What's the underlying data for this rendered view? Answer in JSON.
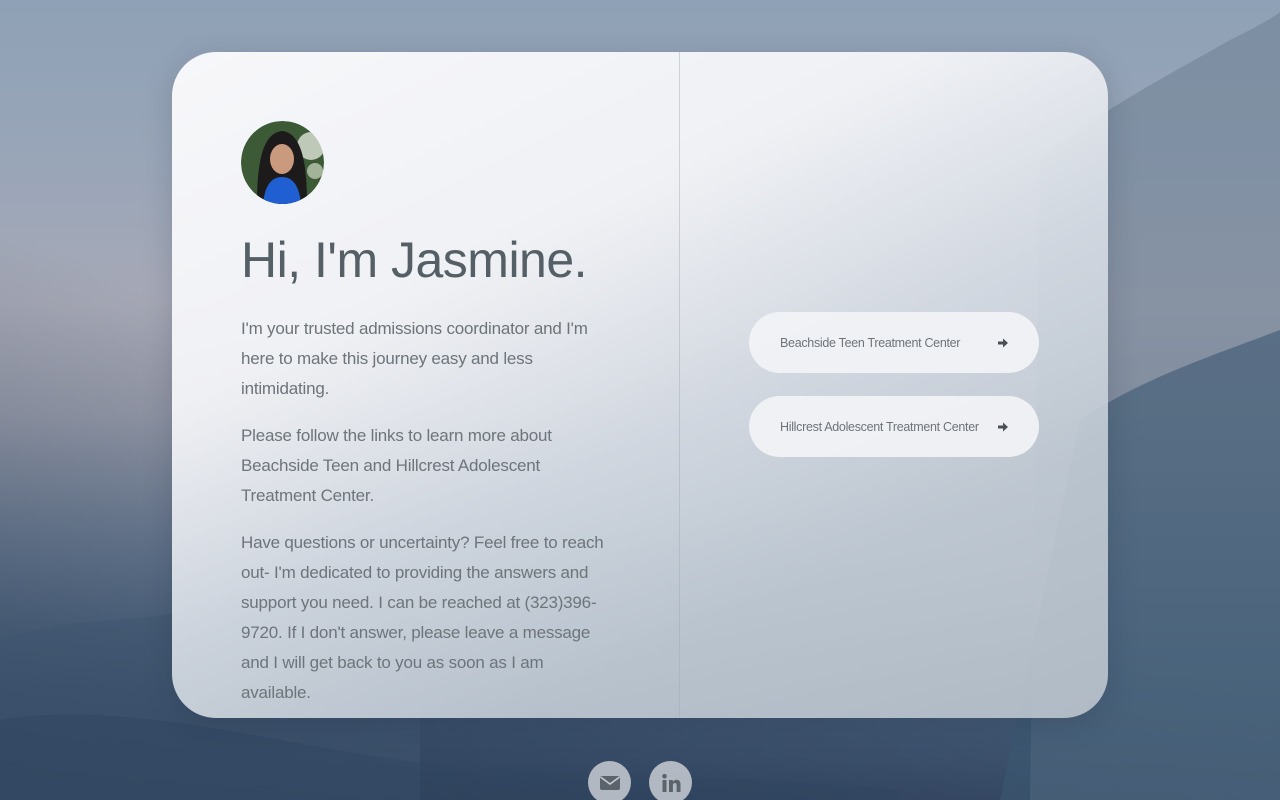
{
  "profile": {
    "greeting": "Hi, I'm Jasmine.",
    "intro": "I'm your trusted admissions coordinator and I'm here to make this journey easy and less intimidating.",
    "links_text": "Please follow the links to learn more about Beachside Teen and Hillcrest Adolescent Treatment Center.",
    "contact_text": "Have questions or uncertainty? Feel free to reach out- I'm dedicated to providing the answers and support you need. I can be reached at (323)396-9720. If I don't answer, please leave a message and I will get back to you as soon as I am available."
  },
  "links": [
    {
      "label": "Beachside Teen Treatment Center",
      "icon": "arrow-right-icon"
    },
    {
      "label": "Hillcrest Adolescent Treatment Center",
      "icon": "arrow-right-icon"
    }
  ],
  "social": [
    {
      "icon": "envelope-icon"
    },
    {
      "icon": "linkedin-icon"
    }
  ],
  "colors": {
    "heading": "#555f66",
    "body_text": "#6d747a",
    "button_bg": "#f2f3f6"
  }
}
